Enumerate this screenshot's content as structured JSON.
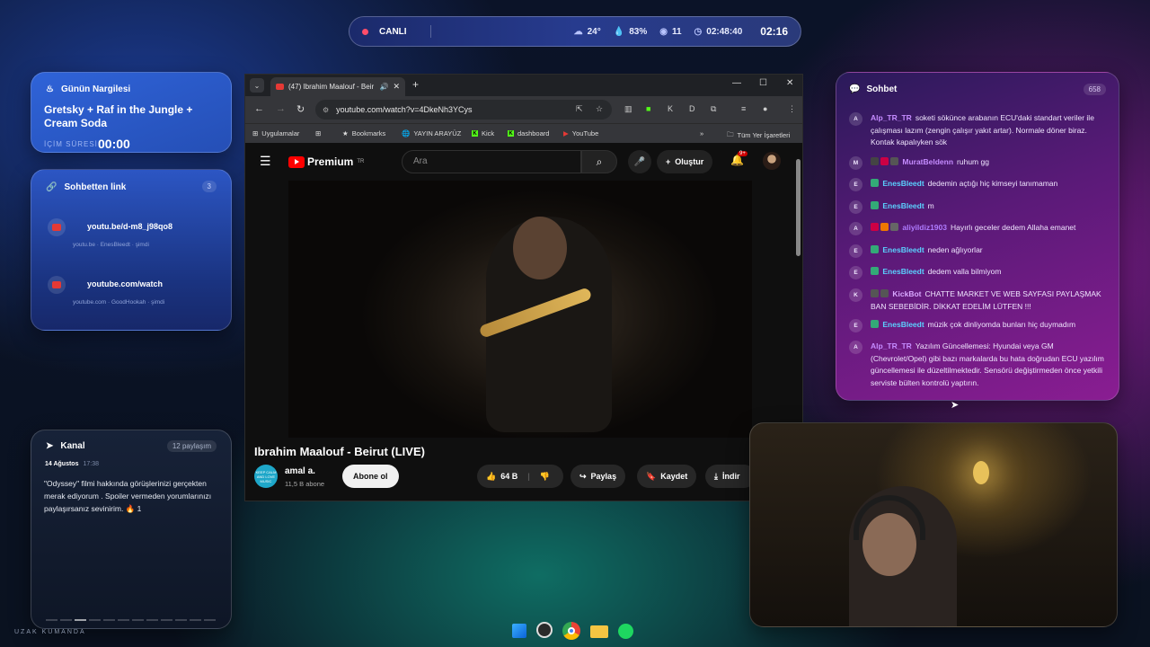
{
  "status": {
    "live": "CANLI",
    "weather": "24°",
    "humidity": "83%",
    "viewers": "11",
    "uptime": "02:48:40",
    "clock": "02:16"
  },
  "nargile": {
    "title": "Günün Nargilesi",
    "drink": "Gretsky + Raf in the Jungle + Cream Soda",
    "time_label": "İÇİM SÜRESİ",
    "time": "00:00"
  },
  "links": {
    "title": "Sohbetten link",
    "count": "3",
    "items": [
      {
        "url": "youtu.be/d-m8_j98qo8",
        "meta": "youtu.be · EnesBleedt · şimdi"
      },
      {
        "url": "youtube.com/watch",
        "meta": "youtube.com · GoodHookah · şimdi"
      }
    ]
  },
  "kanal": {
    "title": "Kanal",
    "count": "12 paylaşım",
    "date": "14 Ağustos",
    "time": "17:38",
    "message": "\"Odyssey\" filmi hakkında görüşlerinizi gerçekten merak ediyorum . Spoiler vermeden yorumlarınızı paylaşırsanız sevinirim. 🔥 1"
  },
  "remote_label": "UZAK KUMANDA",
  "browser": {
    "tab_title": "(47) Ibrahim Maalouf - Beir",
    "url": "youtube.com/watch?v=4DkeNh3YCys",
    "bookmarks": [
      "Uygulamalar",
      "Bookmarks",
      "YAYIN ARAYÜZ",
      "Kick",
      "dashboard",
      "YouTube"
    ],
    "all_bookmarks": "Tüm Yer İşaretleri"
  },
  "youtube": {
    "logo": "Premium",
    "logo_region": "TR",
    "search_placeholder": "Ara",
    "create": "Oluştur",
    "notif_count": "9+",
    "video_title": "Ibrahim Maalouf - Beirut (LIVE)",
    "channel": "amal a.",
    "channel_avatar_text": "KEEP CALM AND LOVE MUSIC",
    "subscribers": "11,5 B abone",
    "subscribe": "Abone ol",
    "likes": "64 B",
    "share": "Paylaş",
    "save": "Kaydet",
    "download": "İndir"
  },
  "chat": {
    "title": "Sohbet",
    "count": "658",
    "messages": [
      {
        "av": "A",
        "user": "Alp_TR_TR",
        "color": "#c58cff",
        "text": "soketi sökünce arabanın ECU'daki standart veriler ile çalışması lazım (zengin çalışır yakıt artar). Normale döner biraz. Kontak kapalıyken sök"
      },
      {
        "av": "M",
        "user": "MuratBeldenn",
        "color": "#c58cff",
        "text": "ruhum gg"
      },
      {
        "av": "E",
        "user": "EnesBleedt",
        "color": "#5ad1ff",
        "text": "dedemin açtığı hiç kimseyi tanımaman"
      },
      {
        "av": "E",
        "user": "EnesBleedt",
        "color": "#5ad1ff",
        "text": "m"
      },
      {
        "av": "A",
        "user": "aliyildiz1903",
        "color": "#b07cff",
        "text": "Hayırlı geceler dedem Allaha emanet"
      },
      {
        "av": "E",
        "user": "EnesBleedt",
        "color": "#5ad1ff",
        "text": "neden ağlıyorlar"
      },
      {
        "av": "E",
        "user": "EnesBleedt",
        "color": "#5ad1ff",
        "text": "dedem valla bilmiyom"
      },
      {
        "av": "K",
        "user": "KickBot",
        "color": "#d9a8ff",
        "text": "CHATTE MARKET VE WEB SAYFASI PAYLAŞMAK BAN SEBEBİDİR. DİKKAT EDELİM LÜTFEN !!!"
      },
      {
        "av": "E",
        "user": "EnesBleedt",
        "color": "#5ad1ff",
        "text": "müzik çok dinliyomda bunları hiç duymadım"
      },
      {
        "av": "A",
        "user": "Alp_TR_TR",
        "color": "#c58cff",
        "text": "Yazılım Güncellemesi: Hyundai veya GM (Chevrolet/Opel) gibi bazı markalarda bu hata doğrudan ECU yazılım güncellemesi ile düzeltilmektedir. Sensörü değiştirmeden önce yetkili serviste bülten kontrolü yaptırın."
      }
    ]
  },
  "icons": [
    "windows-icon",
    "obs-icon",
    "chrome-icon",
    "folder-icon",
    "spotify-icon"
  ]
}
